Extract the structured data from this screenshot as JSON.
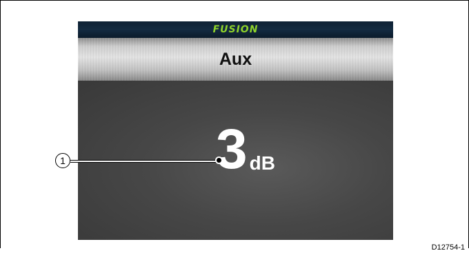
{
  "device": {
    "brand": "FUSION",
    "source_title": "Aux",
    "level": {
      "value": "3",
      "unit": "dB"
    }
  },
  "callout": {
    "number": "1"
  },
  "figure_id": "D12754-1",
  "colors": {
    "brand_green": "#8fd32a",
    "topbar": "#132a40",
    "panel_gray": "#474747"
  }
}
